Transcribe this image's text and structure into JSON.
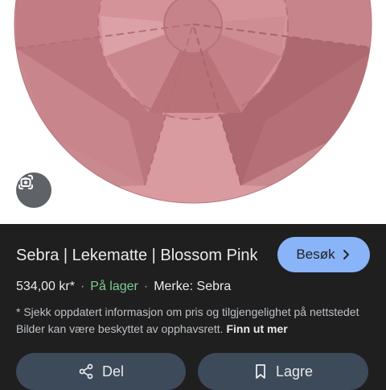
{
  "product": {
    "title": "Sebra | Lekematte | Blossom Pink",
    "price": "534,00 kr*",
    "separator": "·",
    "stock": "På lager",
    "brand": "Merke: Sebra"
  },
  "actions": {
    "visit_label": "Besøk",
    "share_label": "Del",
    "save_label": "Lagre"
  },
  "disclaimer": {
    "text": "* Sjekk oppdatert informasjon om pris og tilgjengelighet på nettstedet Bilder kan være beskyttet av opphavsrett.",
    "more_link": "Finn ut mer"
  },
  "icons": {
    "lens": "google-lens-icon",
    "visit": "chevron-right-icon",
    "share": "share-icon",
    "save": "bookmark-icon"
  },
  "colors": {
    "panel_background": "#1f1f1f",
    "visit_button": "#8ab4f8",
    "stock_text": "#81c995",
    "secondary_button": "#3c4a5a",
    "mat_rose": "#c07a80"
  }
}
